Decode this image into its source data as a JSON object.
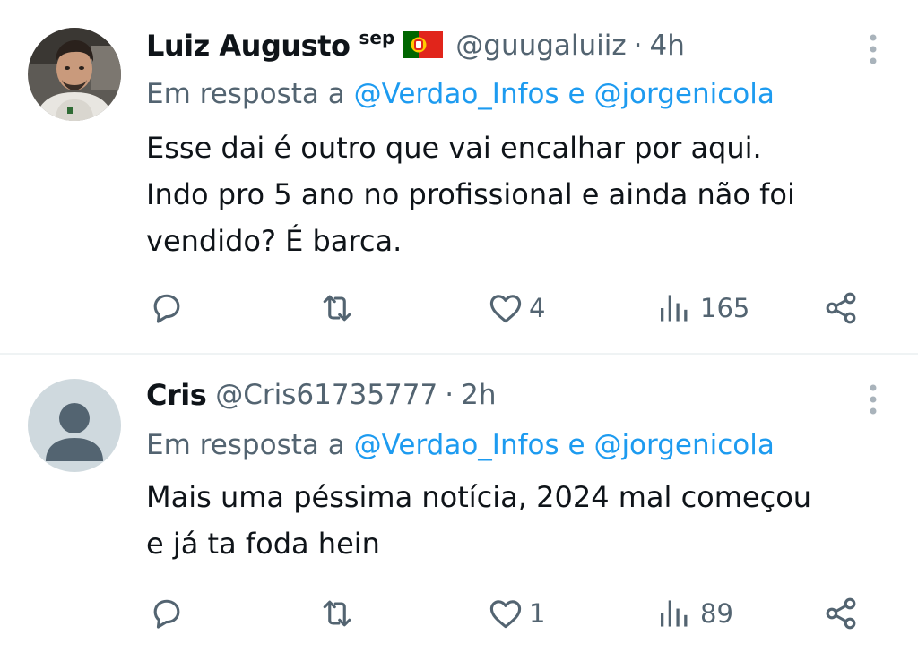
{
  "tweets": [
    {
      "author": {
        "name": "Luiz Augusto",
        "badge": "sep",
        "flag": "portugal-flag",
        "handle": "@guugaluiiz",
        "avatar": "profile-photo"
      },
      "separator": "·",
      "time": "4h",
      "reply": {
        "prefix": "Em resposta a",
        "mention1": "@Verdao_Infos",
        "conj": "e",
        "mention2": "@jorgenicola"
      },
      "text_lines": [
        "Esse dai é outro que vai encalhar por aqui.",
        "Indo pro 5 ano no profissional e ainda não foi",
        "vendido? É barca."
      ],
      "likes": "4",
      "views": "165"
    },
    {
      "author": {
        "name": "Cris",
        "handle": "@Cris61735777",
        "avatar": "default-avatar"
      },
      "separator": "·",
      "time": "2h",
      "reply": {
        "prefix": "Em resposta a",
        "mention1": "@Verdao_Infos",
        "conj": "e",
        "mention2": "@jorgenicola"
      },
      "text_lines": [
        "Mais uma péssima notícia, 2024 mal começou",
        "e já ta foda hein"
      ],
      "likes": "1",
      "views": "89"
    }
  ],
  "icons": {
    "reply": "reply-icon",
    "retweet": "retweet-icon",
    "like": "heart-icon",
    "views": "views-icon",
    "share": "share-icon",
    "menu": "more-options-icon"
  },
  "colors": {
    "text": "#0f1419",
    "secondary": "#536471",
    "link": "#1d9bf0",
    "divider": "#eff3f4"
  }
}
